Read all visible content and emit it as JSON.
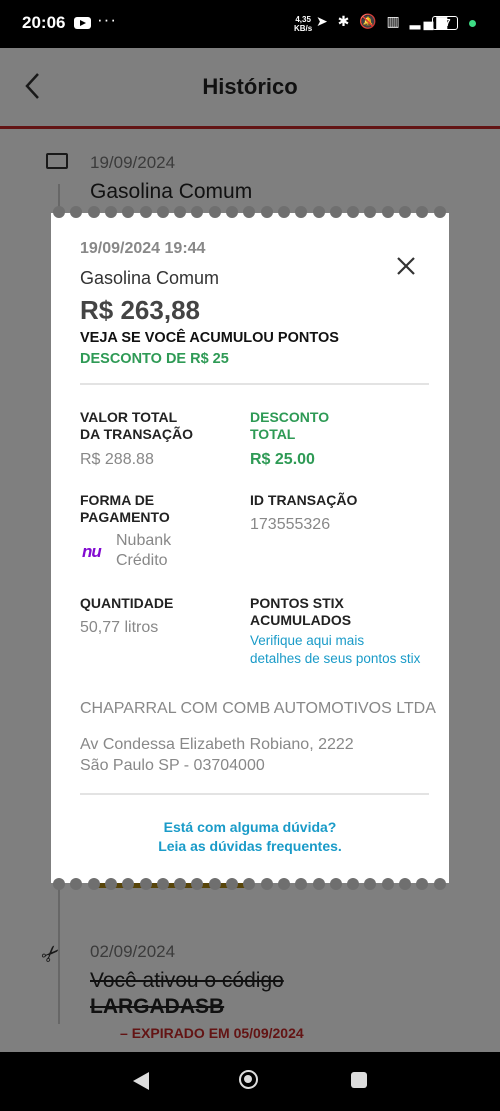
{
  "status_bar": {
    "time": "20:06",
    "dots": "···",
    "network_rate_value": "4,35",
    "network_rate_unit": "KB/s",
    "icons": "➤ ✱ 🔕 ▥ ▂▄▆",
    "battery": "57"
  },
  "app": {
    "title": "Histórico",
    "timeline": [
      {
        "date": "19/09/2024",
        "title": "Gasolina Comum"
      },
      {
        "date": "02/09/2024",
        "title": "Você ativou o código",
        "code": "LARGADASB",
        "status": "EXPIRADO EM 05/09/2024"
      }
    ]
  },
  "modal": {
    "datetime": "19/09/2024 19:44",
    "fuel": "Gasolina Comum",
    "amount": "R$ 263,88",
    "points_prompt": "VEJA SE VOCÊ ACUMULOU PONTOS",
    "discount_note": "DESCONTO DE R$ 25",
    "total_label_1": "VALOR TOTAL",
    "total_label_2": "DA TRANSAÇÃO",
    "total_value": "R$ 288.88",
    "discount_label_1": "DESCONTO",
    "discount_label_2": "TOTAL",
    "discount_value": "R$ 25.00",
    "payment_label_1": "FORMA DE",
    "payment_label_2": "PAGAMENTO",
    "payment_logo": "nu",
    "payment_method_1": "Nubank",
    "payment_method_2": "Crédito",
    "txid_label": "ID TRANSAÇÃO",
    "txid_value": "173555326",
    "quantity_label": "QUANTIDADE",
    "quantity_value": "50,77 litros",
    "stix_label_1": "PONTOS STIX",
    "stix_label_2": "ACUMULADOS",
    "stix_link_1": "Verifique aqui mais",
    "stix_link_2": "detalhes de seus pontos stix",
    "company": "CHAPARRAL COM COMB AUTOMOTIVOS LTDA",
    "address_1": "Av Condessa Elizabeth Robiano, 2222",
    "address_2": "São Paulo SP - 03704000",
    "help_1": "Está com alguma dúvida?",
    "help_2": "Leia as dúvidas frequentes."
  },
  "colors": {
    "accent_red": "#c62828",
    "discount_green": "#2e9a55",
    "link_blue": "#1a9bc8",
    "nubank_purple": "#820ad1"
  }
}
